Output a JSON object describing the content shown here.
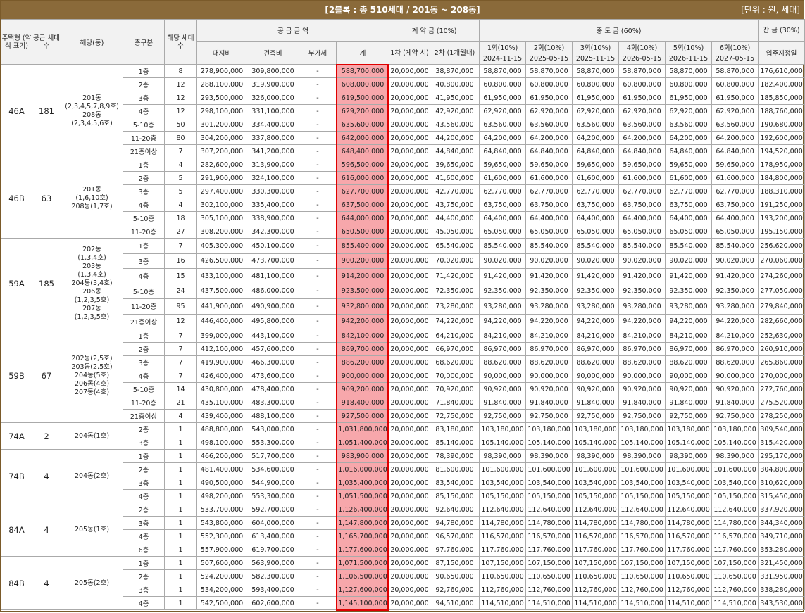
{
  "title": "[2블록 : 총 510세대 / 201동 ~ 208동]",
  "unit": "[단위 : 원, 세대]",
  "headers": {
    "type": "주택형 (약식 표기)",
    "supply_units": "공급 세대수",
    "dong": "해당(동)",
    "floor": "층구분",
    "units": "해당 세대수",
    "supply_price": "공 급 금 액",
    "land": "대지비",
    "building": "건축비",
    "vat": "부가세",
    "total": "계",
    "deposit": "계 약 금 (10%)",
    "deposit1": "1차 (계약 시)",
    "deposit2": "2차 (1개월내)",
    "middle": "중 도 금 (60%)",
    "m1": "1회(10%)",
    "m1d": "2024-11-15",
    "m2": "2회(10%)",
    "m2d": "2025-05-15",
    "m3": "3회(10%)",
    "m3d": "2025-11-15",
    "m4": "4회(10%)",
    "m4d": "2026-05-15",
    "m5": "5회(10%)",
    "m5d": "2026-11-15",
    "m6": "6회(10%)",
    "m6d": "2027-05-15",
    "balance": "잔 금 (30%)",
    "balance_sub": "입주지정일"
  },
  "groups": [
    {
      "type": "46A",
      "count": "181",
      "dong": "201동\n(2,3,4,5,7,8,9호)\n208동\n(2,3,4,5,6호)",
      "rows": [
        [
          "1층",
          "8",
          "278,900,000",
          "309,800,000",
          "-",
          "588,700,000",
          "20,000,000",
          "38,870,000",
          "58,870,000",
          "176,610,000"
        ],
        [
          "2층",
          "12",
          "288,100,000",
          "319,900,000",
          "-",
          "608,000,000",
          "20,000,000",
          "40,800,000",
          "60,800,000",
          "182,400,000"
        ],
        [
          "3층",
          "12",
          "293,500,000",
          "326,000,000",
          "-",
          "619,500,000",
          "20,000,000",
          "41,950,000",
          "61,950,000",
          "185,850,000"
        ],
        [
          "4층",
          "12",
          "298,100,000",
          "331,100,000",
          "-",
          "629,200,000",
          "20,000,000",
          "42,920,000",
          "62,920,000",
          "188,760,000"
        ],
        [
          "5-10층",
          "50",
          "301,200,000",
          "334,400,000",
          "-",
          "635,600,000",
          "20,000,000",
          "43,560,000",
          "63,560,000",
          "190,680,000"
        ],
        [
          "11-20층",
          "80",
          "304,200,000",
          "337,800,000",
          "-",
          "642,000,000",
          "20,000,000",
          "44,200,000",
          "64,200,000",
          "192,600,000"
        ],
        [
          "21층이상",
          "7",
          "307,200,000",
          "341,200,000",
          "-",
          "648,400,000",
          "20,000,000",
          "44,840,000",
          "64,840,000",
          "194,520,000"
        ]
      ]
    },
    {
      "type": "46B",
      "count": "63",
      "dong": "201동\n(1,6,10호)\n208동(1,7호)",
      "rows": [
        [
          "1층",
          "4",
          "282,600,000",
          "313,900,000",
          "-",
          "596,500,000",
          "20,000,000",
          "39,650,000",
          "59,650,000",
          "178,950,000"
        ],
        [
          "2층",
          "5",
          "291,900,000",
          "324,100,000",
          "-",
          "616,000,000",
          "20,000,000",
          "41,600,000",
          "61,600,000",
          "184,800,000"
        ],
        [
          "3층",
          "5",
          "297,400,000",
          "330,300,000",
          "-",
          "627,700,000",
          "20,000,000",
          "42,770,000",
          "62,770,000",
          "188,310,000"
        ],
        [
          "4층",
          "4",
          "302,100,000",
          "335,400,000",
          "-",
          "637,500,000",
          "20,000,000",
          "43,750,000",
          "63,750,000",
          "191,250,000"
        ],
        [
          "5-10층",
          "18",
          "305,100,000",
          "338,900,000",
          "-",
          "644,000,000",
          "20,000,000",
          "44,400,000",
          "64,400,000",
          "193,200,000"
        ],
        [
          "11-20층",
          "27",
          "308,200,000",
          "342,300,000",
          "-",
          "650,500,000",
          "20,000,000",
          "45,050,000",
          "65,050,000",
          "195,150,000"
        ]
      ]
    },
    {
      "type": "59A",
      "count": "185",
      "dong": "202동\n(1,3,4호)\n203동\n(1,3,4호)\n204동(3,4호)\n206동\n(1,2,3,5호)\n207동\n(1,2,3,5호)",
      "rows": [
        [
          "1층",
          "7",
          "405,300,000",
          "450,100,000",
          "-",
          "855,400,000",
          "20,000,000",
          "65,540,000",
          "85,540,000",
          "256,620,000"
        ],
        [
          "3층",
          "16",
          "426,500,000",
          "473,700,000",
          "-",
          "900,200,000",
          "20,000,000",
          "70,020,000",
          "90,020,000",
          "270,060,000"
        ],
        [
          "4층",
          "15",
          "433,100,000",
          "481,100,000",
          "-",
          "914,200,000",
          "20,000,000",
          "71,420,000",
          "91,420,000",
          "274,260,000"
        ],
        [
          "5-10층",
          "24",
          "437,500,000",
          "486,000,000",
          "-",
          "923,500,000",
          "20,000,000",
          "72,350,000",
          "92,350,000",
          "277,050,000"
        ],
        [
          "11-20층",
          "95",
          "441,900,000",
          "490,900,000",
          "-",
          "932,800,000",
          "20,000,000",
          "73,280,000",
          "93,280,000",
          "279,840,000"
        ],
        [
          "21층이상",
          "12",
          "446,400,000",
          "495,800,000",
          "-",
          "942,200,000",
          "20,000,000",
          "74,220,000",
          "94,220,000",
          "282,660,000"
        ]
      ]
    },
    {
      "type": "59B",
      "count": "67",
      "dong": "202동(2,5호)\n203동(2,5호)\n204동(5호)\n206동(4호)\n207동(4호)",
      "rows": [
        [
          "1층",
          "7",
          "399,000,000",
          "443,100,000",
          "-",
          "842,100,000",
          "20,000,000",
          "64,210,000",
          "84,210,000",
          "252,630,000"
        ],
        [
          "2층",
          "7",
          "412,100,000",
          "457,600,000",
          "-",
          "869,700,000",
          "20,000,000",
          "66,970,000",
          "86,970,000",
          "260,910,000"
        ],
        [
          "3층",
          "7",
          "419,900,000",
          "466,300,000",
          "-",
          "886,200,000",
          "20,000,000",
          "68,620,000",
          "88,620,000",
          "265,860,000"
        ],
        [
          "4층",
          "7",
          "426,400,000",
          "473,600,000",
          "-",
          "900,000,000",
          "20,000,000",
          "70,000,000",
          "90,000,000",
          "270,000,000"
        ],
        [
          "5-10층",
          "14",
          "430,800,000",
          "478,400,000",
          "-",
          "909,200,000",
          "20,000,000",
          "70,920,000",
          "90,920,000",
          "272,760,000"
        ],
        [
          "11-20층",
          "21",
          "435,100,000",
          "483,300,000",
          "-",
          "918,400,000",
          "20,000,000",
          "71,840,000",
          "91,840,000",
          "275,520,000"
        ],
        [
          "21층이상",
          "4",
          "439,400,000",
          "488,100,000",
          "-",
          "927,500,000",
          "20,000,000",
          "72,750,000",
          "92,750,000",
          "278,250,000"
        ]
      ]
    },
    {
      "type": "74A",
      "count": "2",
      "dong": "204동(1호)",
      "rows": [
        [
          "2층",
          "1",
          "488,800,000",
          "543,000,000",
          "-",
          "1,031,800,000",
          "20,000,000",
          "83,180,000",
          "103,180,000",
          "309,540,000"
        ],
        [
          "3층",
          "1",
          "498,100,000",
          "553,300,000",
          "-",
          "1,051,400,000",
          "20,000,000",
          "85,140,000",
          "105,140,000",
          "315,420,000"
        ]
      ]
    },
    {
      "type": "74B",
      "count": "4",
      "dong": "204동(2호)",
      "rows": [
        [
          "1층",
          "1",
          "466,200,000",
          "517,700,000",
          "-",
          "983,900,000",
          "20,000,000",
          "78,390,000",
          "98,390,000",
          "295,170,000"
        ],
        [
          "2층",
          "1",
          "481,400,000",
          "534,600,000",
          "-",
          "1,016,000,000",
          "20,000,000",
          "81,600,000",
          "101,600,000",
          "304,800,000"
        ],
        [
          "3층",
          "1",
          "490,500,000",
          "544,900,000",
          "-",
          "1,035,400,000",
          "20,000,000",
          "83,540,000",
          "103,540,000",
          "310,620,000"
        ],
        [
          "4층",
          "1",
          "498,200,000",
          "553,300,000",
          "-",
          "1,051,500,000",
          "20,000,000",
          "85,150,000",
          "105,150,000",
          "315,450,000"
        ]
      ]
    },
    {
      "type": "84A",
      "count": "4",
      "dong": "205동(1호)",
      "rows": [
        [
          "2층",
          "1",
          "533,700,000",
          "592,700,000",
          "-",
          "1,126,400,000",
          "20,000,000",
          "92,640,000",
          "112,640,000",
          "337,920,000"
        ],
        [
          "3층",
          "1",
          "543,800,000",
          "604,000,000",
          "-",
          "1,147,800,000",
          "20,000,000",
          "94,780,000",
          "114,780,000",
          "344,340,000"
        ],
        [
          "4층",
          "1",
          "552,300,000",
          "613,400,000",
          "-",
          "1,165,700,000",
          "20,000,000",
          "96,570,000",
          "116,570,000",
          "349,710,000"
        ],
        [
          "6층",
          "1",
          "557,900,000",
          "619,700,000",
          "-",
          "1,177,600,000",
          "20,000,000",
          "97,760,000",
          "117,760,000",
          "353,280,000"
        ]
      ]
    },
    {
      "type": "84B",
      "count": "4",
      "dong": "205동(2호)",
      "rows": [
        [
          "1층",
          "1",
          "507,600,000",
          "563,900,000",
          "-",
          "1,071,500,000",
          "20,000,000",
          "87,150,000",
          "107,150,000",
          "321,450,000"
        ],
        [
          "2층",
          "1",
          "524,200,000",
          "582,300,000",
          "-",
          "1,106,500,000",
          "20,000,000",
          "90,650,000",
          "110,650,000",
          "331,950,000"
        ],
        [
          "3층",
          "1",
          "534,200,000",
          "593,400,000",
          "-",
          "1,127,600,000",
          "20,000,000",
          "92,760,000",
          "112,760,000",
          "338,280,000"
        ],
        [
          "4층",
          "1",
          "542,500,000",
          "602,600,000",
          "-",
          "1,145,100,000",
          "20,000,000",
          "94,510,000",
          "114,510,000",
          "343,530,000"
        ]
      ]
    }
  ]
}
